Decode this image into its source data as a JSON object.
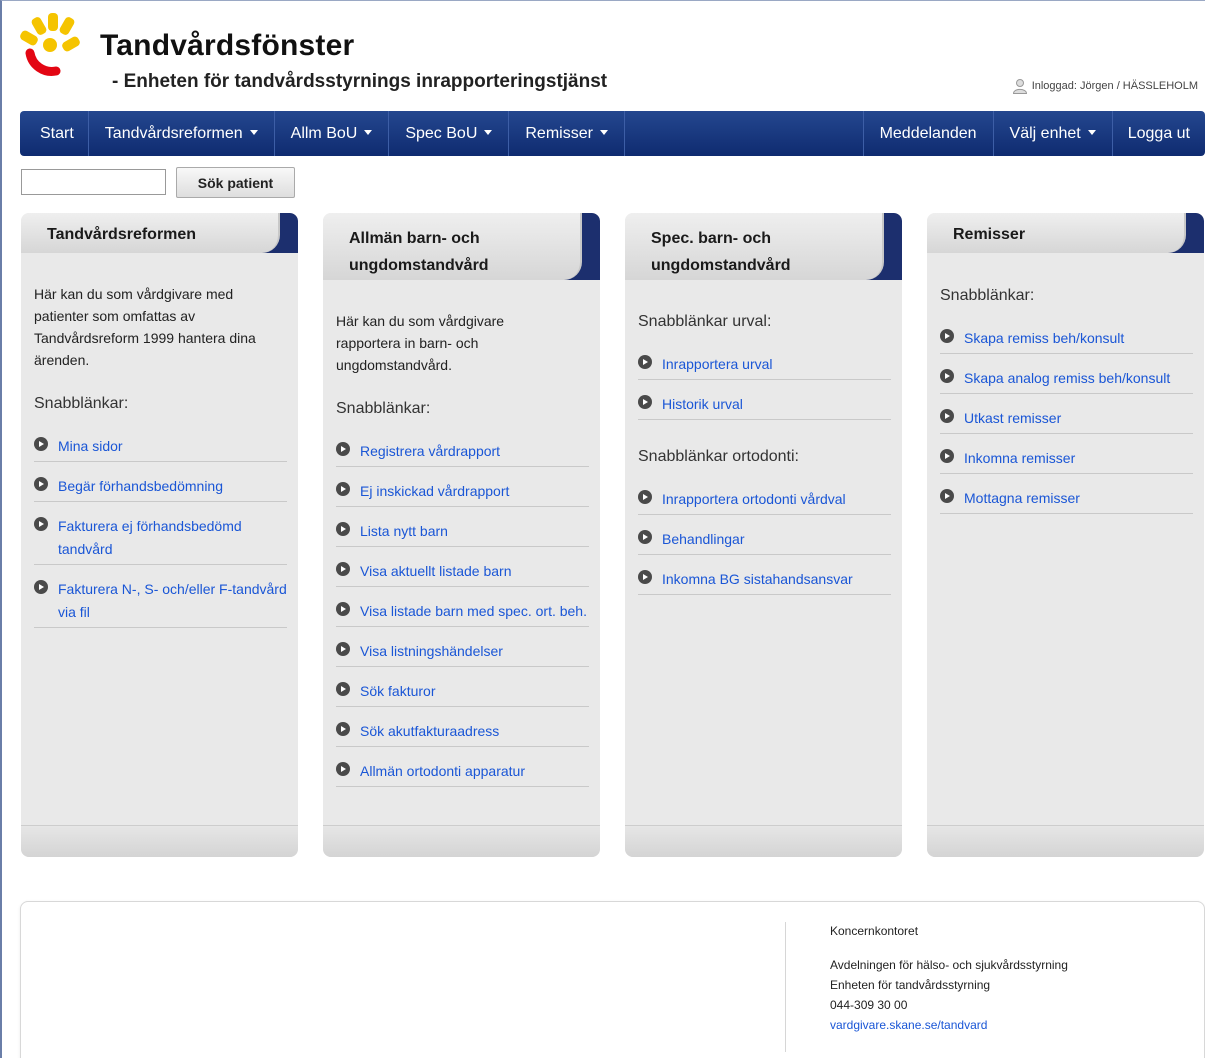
{
  "header": {
    "title": "Tandvårdsfönster",
    "subtitle": "- Enheten för tandvårdsstyrnings inrapporteringstjänst",
    "user_label": "Inloggad: Jörgen / HÄSSLEHOLM",
    "logo_colors": [
      "#f5c400",
      "#e30613"
    ]
  },
  "nav": {
    "left": [
      {
        "label": "Start",
        "dropdown": false
      },
      {
        "label": "Tandvårdsreformen",
        "dropdown": true
      },
      {
        "label": "Allm BoU",
        "dropdown": true
      },
      {
        "label": "Spec BoU",
        "dropdown": true
      },
      {
        "label": "Remisser",
        "dropdown": true
      }
    ],
    "right": [
      {
        "label": "Meddelanden",
        "dropdown": false
      },
      {
        "label": "Välj enhet",
        "dropdown": true
      },
      {
        "label": "Logga ut",
        "dropdown": false
      }
    ]
  },
  "search": {
    "value": "",
    "button_label": "Sök patient"
  },
  "panels": [
    {
      "title": "Tandvårdsreformen",
      "intro": "Här kan du som vårdgivare med patienter som omfattas av Tandvårdsreform 1999 hantera dina ärenden.",
      "sections": [
        {
          "heading": "Snabblänkar:",
          "links": [
            "Mina sidor",
            "Begär förhandsbedömning",
            "Fakturera ej förhandsbedömd tandvård",
            "Fakturera N-, S- och/eller F-tandvård via fil"
          ]
        }
      ]
    },
    {
      "title": "Allmän barn- och ungdomstandvård",
      "intro": "Här kan du som vårdgivare rapportera in barn- och ungdomstandvård.",
      "sections": [
        {
          "heading": "Snabblänkar:",
          "links": [
            "Registrera vårdrapport",
            "Ej inskickad vårdrapport",
            "Lista nytt barn",
            "Visa aktuellt listade barn",
            "Visa listade barn med spec. ort. beh.",
            "Visa listningshändelser",
            "Sök fakturor",
            "Sök akutfakturaadress",
            "Allmän ortodonti apparatur"
          ]
        }
      ]
    },
    {
      "title": "Spec. barn- och ungdomstandvård",
      "intro": "",
      "sections": [
        {
          "heading": "Snabblänkar urval:",
          "links": [
            "Inrapportera urval",
            "Historik urval"
          ]
        },
        {
          "heading": "Snabblänkar ortodonti:",
          "links": [
            "Inrapportera ortodonti vårdval",
            "Behandlingar",
            "Inkomna BG sistahandsansvar"
          ]
        }
      ]
    },
    {
      "title": "Remisser",
      "intro": "",
      "sections": [
        {
          "heading": "Snabblänkar:",
          "links": [
            "Skapa remiss beh/konsult",
            "Skapa analog remiss beh/konsult",
            "Utkast remisser",
            "Inkomna remisser",
            "Mottagna remisser"
          ]
        }
      ]
    }
  ],
  "footer": {
    "org": "Koncernkontoret",
    "lines": [
      "Avdelningen för hälso- och sjukvårdsstyrning",
      "Enheten för tandvårdsstyrning",
      "044-309 30 00"
    ],
    "link": "vardgivare.skane.se/tandvard"
  }
}
